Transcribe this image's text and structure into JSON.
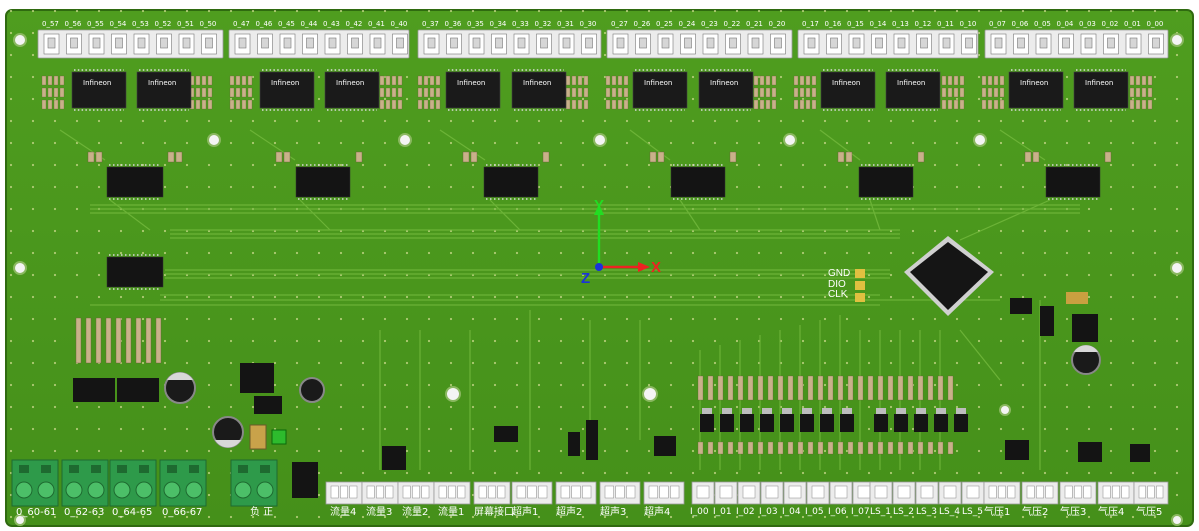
{
  "board": {
    "colors": {
      "pcb": "#4e9a1e",
      "pcb_dark": "#2f6a10",
      "trace": "#6fb33a",
      "silk": "#ffffff",
      "chip": "#1a1a1a",
      "connector": "#e8e8e8",
      "terminal": "#2e9a4a",
      "resistor": "#c9b18a",
      "pad": "#d4c08a"
    },
    "top_labels": [
      "0_57",
      "0_56",
      "0_55",
      "0_54",
      "0_53",
      "0_52",
      "0_51",
      "0_50",
      "0_47",
      "0_46",
      "0_45",
      "0_44",
      "0_43",
      "0_42",
      "0_41",
      "0_40",
      "0_37",
      "0_36",
      "0_35",
      "0_34",
      "0_33",
      "0_32",
      "0_31",
      "0_30",
      "0_27",
      "0_26",
      "0_25",
      "0_24",
      "0_23",
      "0_22",
      "0_21",
      "0_20",
      "0_17",
      "0_16",
      "0_15",
      "0_14",
      "0_13",
      "0_12",
      "0_11",
      "0_10",
      "0_07",
      "0_06",
      "0_05",
      "0_04",
      "0_03",
      "0_02",
      "0_01",
      "0_00"
    ],
    "infineon_label": "Infineon",
    "axes": {
      "x": "X",
      "y": "Y",
      "z": "Z"
    },
    "swd_labels": {
      "gnd": "GND",
      "dio": "DIO",
      "clk": "CLK"
    },
    "bottom_labels": [
      "0_60-61",
      "0_62-63",
      "0_64-65",
      "0_66-67",
      "负 正",
      "流量4",
      "流量3",
      "流量2",
      "流量1",
      "屏幕接口",
      "超声1",
      "超声2",
      "超声3",
      "超声4",
      "I_00",
      "I_01",
      "I_02",
      "I_03",
      "I_04",
      "I_05",
      "I_06",
      "I_07",
      "LS_1",
      "LS_2",
      "LS_3",
      "LS_4",
      "LS_5",
      "气压1",
      "气压2",
      "气压3",
      "气压4",
      "气压5"
    ]
  }
}
